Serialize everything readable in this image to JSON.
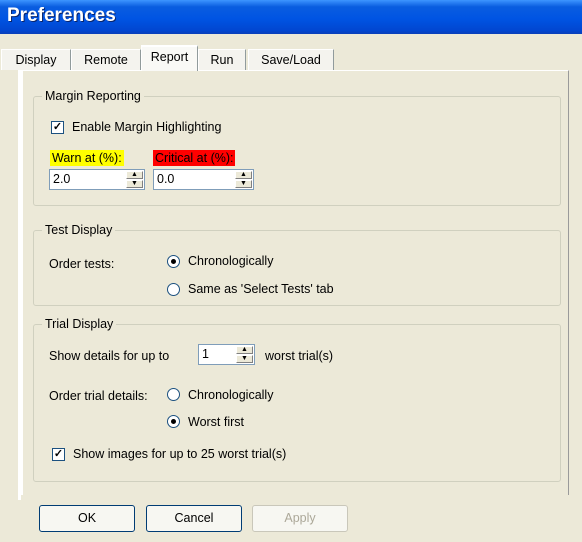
{
  "window": {
    "title": "Preferences"
  },
  "tabs": [
    {
      "label": "Display"
    },
    {
      "label": "Remote"
    },
    {
      "label": "Report"
    },
    {
      "label": "Run"
    },
    {
      "label": "Save/Load"
    }
  ],
  "active_tab": "Report",
  "margin_reporting": {
    "legend": "Margin Reporting",
    "enable_label": "Enable Margin Highlighting",
    "enable_checked": true,
    "warn_label": "Warn at (%):",
    "warn_value": "2.0",
    "critical_label": "Critical at (%):",
    "critical_value": "0.0",
    "warn_color": "#ffff00",
    "critical_color": "#ff0000"
  },
  "test_display": {
    "legend": "Test Display",
    "order_label": "Order tests:",
    "option_chronological": "Chronologically",
    "option_select_tests": "Same as 'Select Tests' tab",
    "selected": "Chronologically"
  },
  "trial_display": {
    "legend": "Trial Display",
    "show_details_label": "Show details for up to",
    "show_details_value": "1",
    "worst_trials_label": "worst trial(s)",
    "order_details_label": "Order trial details:",
    "option_chronological": "Chronologically",
    "option_worst_first": "Worst first",
    "selected": "Worst first",
    "show_images_label": "Show images for up to 25 worst trial(s)",
    "show_images_checked": true
  },
  "buttons": {
    "ok": "OK",
    "cancel": "Cancel",
    "apply": "Apply"
  }
}
